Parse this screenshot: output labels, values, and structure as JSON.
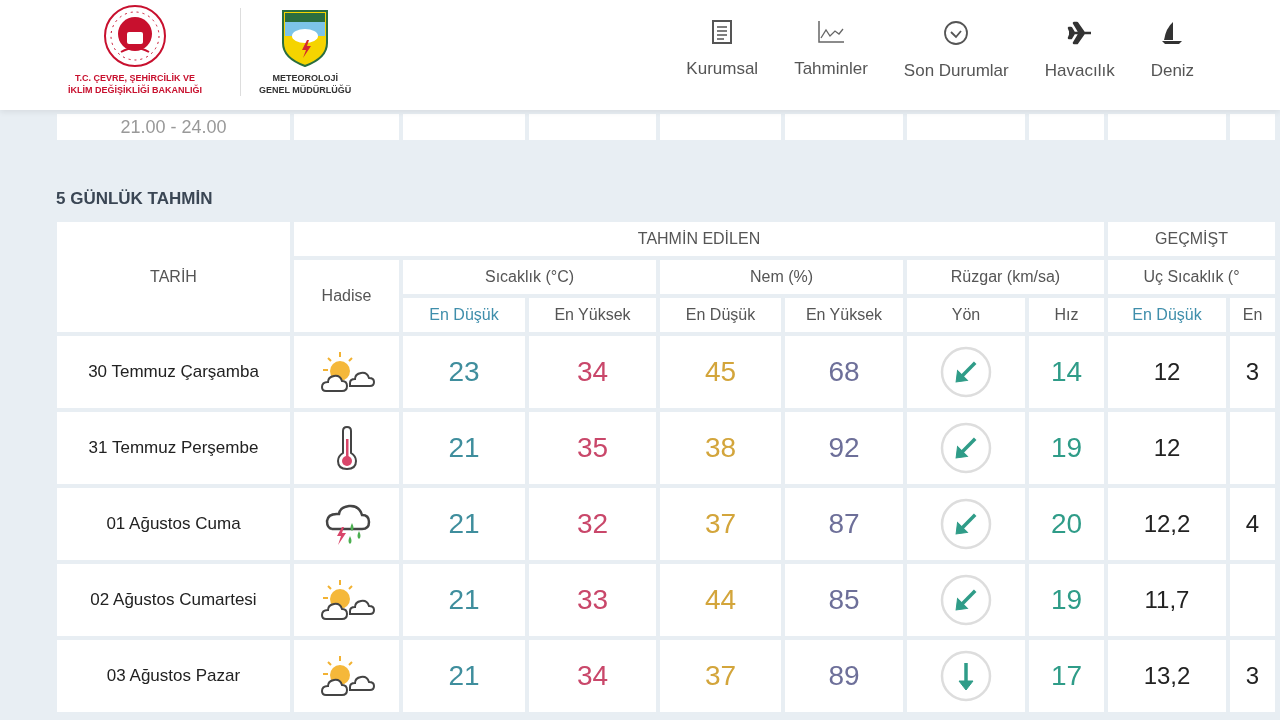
{
  "header": {
    "ministry_lines": [
      "T.C. ÇEVRE, ŞEHİRCİLİK VE",
      "İKLİM DEĞİŞİKLİĞİ BAKANLIĞI"
    ],
    "agency_lines": [
      "METEOROLOJİ",
      "GENEL MÜDÜRLÜĞÜ"
    ]
  },
  "nav": [
    {
      "label": "Kurumsal"
    },
    {
      "label": "Tahminler"
    },
    {
      "label": "Son Durumlar"
    },
    {
      "label": "Havacılık"
    },
    {
      "label": "Deniz"
    }
  ],
  "previous_row": {
    "time": "21.00 - 24.00"
  },
  "forecast": {
    "title": "5 GÜNLÜK TAHMİN",
    "date_header": "TARİH",
    "event_header": "Hadise",
    "group_headers": [
      "TAHMİN EDİLEN",
      "GEÇMİŞT"
    ],
    "sub_headers": [
      "Sıcaklık (°C)",
      "Nem (%)",
      "Rüzgar (km/sa)",
      "Uç Sıcaklık (°"
    ],
    "columns": [
      {
        "label": "En Düşük",
        "kind": "temp_low"
      },
      {
        "label": "En Yüksek",
        "kind": "temp_high"
      },
      {
        "label": "En Düşük",
        "kind": "hum_low"
      },
      {
        "label": "En Yüksek",
        "kind": "hum_high"
      },
      {
        "label": "Yön",
        "kind": "direction"
      },
      {
        "label": "Hız",
        "kind": "speed"
      },
      {
        "label": "En Düşük",
        "kind": "temp_low"
      },
      {
        "label": "En",
        "kind": "temp_high"
      }
    ],
    "rows": [
      {
        "date": "30 Temmuz Çarşamba",
        "kind": "partly_cloudy",
        "temp_low": "23",
        "temp_high": "34",
        "hum_low": "45",
        "hum_high": "68",
        "wind": {
          "kind": "southwest",
          "speed": "14"
        },
        "past_low": "12",
        "past_high": "3"
      },
      {
        "date": "31 Temmuz Perşembe",
        "kind": "hot",
        "temp_low": "21",
        "temp_high": "35",
        "hum_low": "38",
        "hum_high": "92",
        "wind": {
          "kind": "southwest",
          "speed": "19"
        },
        "past_low": "12"
      },
      {
        "date": "01 Ağustos Cuma",
        "kind": "thunderstorm",
        "temp_low": "21",
        "temp_high": "32",
        "hum_low": "37",
        "hum_high": "87",
        "wind": {
          "kind": "southwest",
          "speed": "20"
        },
        "past_low": "12,2",
        "past_high": "4"
      },
      {
        "date": "02 Ağustos Cumartesi",
        "kind": "partly_cloudy",
        "temp_low": "21",
        "temp_high": "33",
        "hum_low": "44",
        "hum_high": "85",
        "wind": {
          "kind": "southwest",
          "speed": "19"
        },
        "past_low": "11,7"
      },
      {
        "date": "03 Ağustos Pazar",
        "kind": "partly_cloudy",
        "temp_low": "21",
        "temp_high": "34",
        "hum_low": "37",
        "hum_high": "89",
        "wind": {
          "kind": "south",
          "speed": "17"
        },
        "past_low": "13,2",
        "past_high": "3"
      }
    ]
  }
}
